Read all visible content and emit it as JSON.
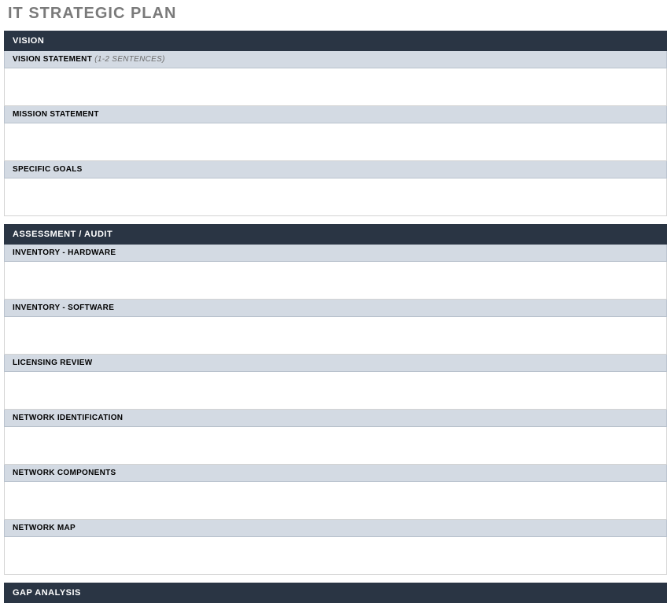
{
  "title": "IT STRATEGIC PLAN",
  "sections": [
    {
      "header": "VISION",
      "subsections": [
        {
          "label": "VISION STATEMENT",
          "hint": "(1-2 SENTENCES)"
        },
        {
          "label": "MISSION STATEMENT",
          "hint": ""
        },
        {
          "label": "SPECIFIC GOALS",
          "hint": ""
        }
      ]
    },
    {
      "header": "ASSESSMENT / AUDIT",
      "subsections": [
        {
          "label": "INVENTORY - HARDWARE",
          "hint": ""
        },
        {
          "label": "INVENTORY - SOFTWARE",
          "hint": ""
        },
        {
          "label": "LICENSING REVIEW",
          "hint": ""
        },
        {
          "label": "NETWORK IDENTIFICATION",
          "hint": ""
        },
        {
          "label": "NETWORK COMPONENTS",
          "hint": ""
        },
        {
          "label": "NETWORK MAP",
          "hint": ""
        }
      ]
    },
    {
      "header": "GAP ANALYSIS",
      "subsections": []
    }
  ]
}
